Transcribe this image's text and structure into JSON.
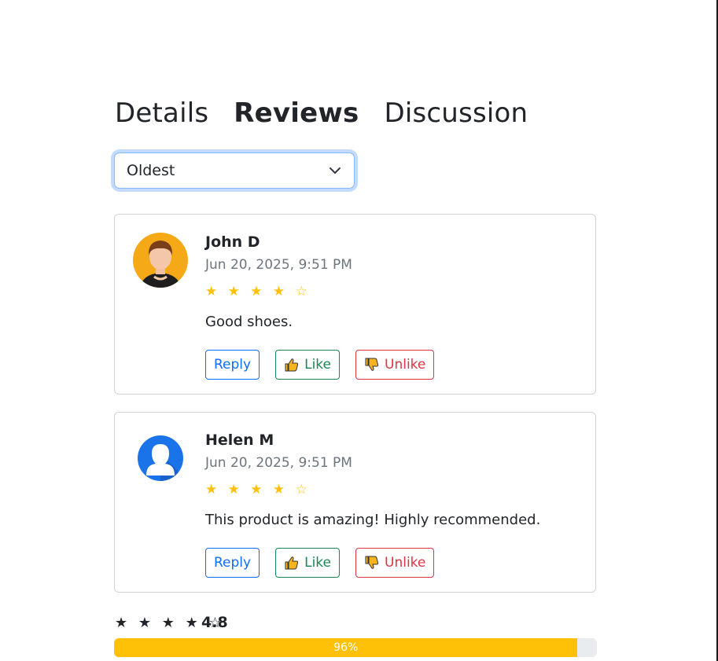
{
  "tabs": [
    {
      "label": "Details",
      "active": false
    },
    {
      "label": "Reviews",
      "active": true
    },
    {
      "label": "Discussion",
      "active": false
    }
  ],
  "sort": {
    "selected": "Oldest",
    "icon": "chevron-down-icon"
  },
  "reviews": [
    {
      "name": "John D",
      "date": "Jun 20, 2025, 9:51 PM",
      "stars": "★ ★ ★ ★ ☆",
      "rating": 4,
      "text": "Good shoes.",
      "avatar": "male-avatar-icon",
      "reply_label": "Reply",
      "like_label": "Like",
      "unlike_label": "Unlike"
    },
    {
      "name": "Helen M",
      "date": "Jun 20, 2025, 9:51 PM",
      "stars": "★ ★ ★ ★ ☆",
      "rating": 4,
      "text": "This product is amazing! Highly recommended.",
      "avatar": "user-silhouette-icon",
      "reply_label": "Reply",
      "like_label": "Like",
      "unlike_label": "Unlike"
    }
  ],
  "summary": {
    "stars": "★ ★ ★ ★ ☆",
    "score": "4.8",
    "progress_label": "96%",
    "progress_value": 0.96
  },
  "colors": {
    "star": "#ffc107",
    "reply": "#0d6efd",
    "like": "#198754",
    "unlike": "#dc3545",
    "progress": "#ffc107"
  }
}
